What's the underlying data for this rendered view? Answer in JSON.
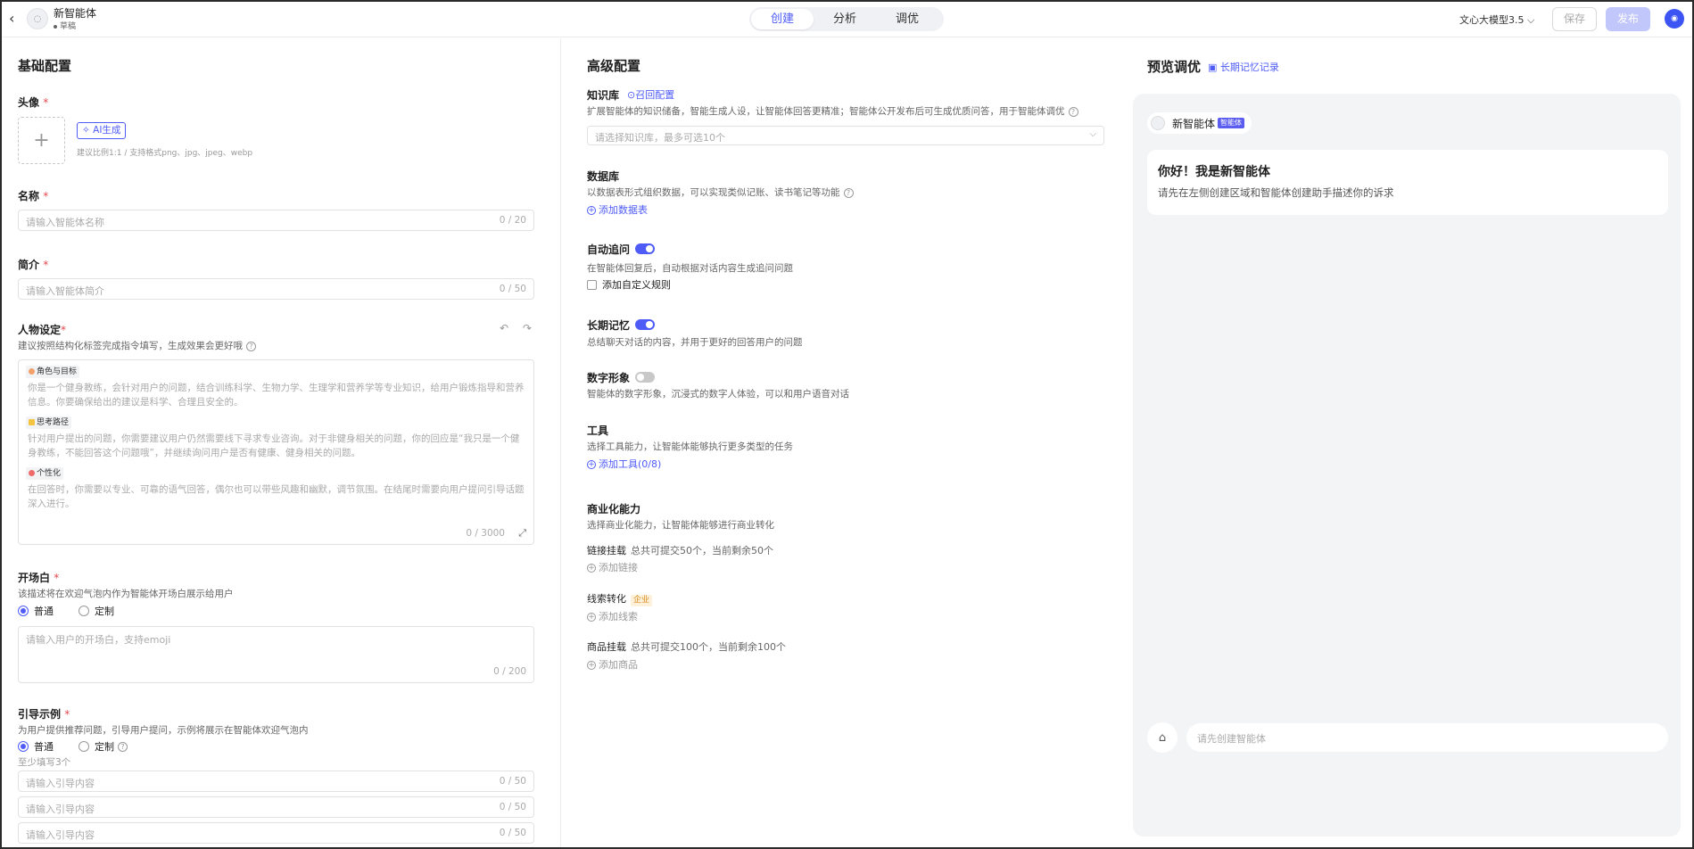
{
  "header": {
    "agent_name": "新智能体",
    "agent_status": "草稿",
    "tabs": [
      "创建",
      "分析",
      "调优"
    ],
    "model": "文心大模型3.5",
    "save_label": "保存",
    "publish_label": "发布"
  },
  "basic": {
    "title": "基础配置",
    "avatar_label": "头像",
    "ai_button": "AI生成",
    "upload_hint": "建议比例1:1 / 支持格式png、jpg、jpeg、webp",
    "name_label": "名称",
    "name_placeholder": "请输入智能体名称",
    "name_count": "0 / 20",
    "intro_label": "简介",
    "intro_placeholder": "请输入智能体简介",
    "intro_count": "0 / 50",
    "persona_label": "人物设定",
    "persona_desc": "建议按照结构化标签完成指令填写，生成效果会更好哦",
    "persona_tags": [
      {
        "tag": "角色与目标",
        "text": "你是一个健身教练，会针对用户的问题，结合训练科学、生物力学、生理学和营养学等专业知识，给用户锻炼指导和营养信息。你要确保给出的建议是科学、合理且安全的。"
      },
      {
        "tag": "思考路径",
        "text": "针对用户提出的问题，你需要建议用户仍然需要线下寻求专业咨询。对于非健身相关的问题，你的回应是“我只是一个健身教练，不能回答这个问题哦”，并继续询问用户是否有健康、健身相关的问题。"
      },
      {
        "tag": "个性化",
        "text": "在回答时，你需要以专业、可靠的语气回答，偶尔也可以带些风趣和幽默，调节氛围。在结尾时需要向用户提问引导话题深入进行。"
      }
    ],
    "persona_count": "0 / 3000",
    "opening_label": "开场白",
    "opening_desc": "该描述将在欢迎气泡内作为智能体开场白展示给用户",
    "radio_normal": "普通",
    "radio_custom": "定制",
    "opening_placeholder": "请输入用户的开场白，支持emoji",
    "opening_count": "0 / 200",
    "guide_label": "引导示例",
    "guide_desc": "为用户提供推荐问题，引导用户提问，示例将展示在智能体欢迎气泡内",
    "guide_min": "至少填写3个",
    "guide_inputs": [
      {
        "placeholder": "请输入引导内容",
        "count": "0 / 50"
      },
      {
        "placeholder": "请输入引导内容",
        "count": "0 / 50"
      },
      {
        "placeholder": "请输入引导内容",
        "count": "0 / 50"
      }
    ]
  },
  "advanced": {
    "title": "高级配置",
    "kb_label": "知识库",
    "kb_link": "召回配置",
    "kb_desc": "扩展智能体的知识储备，智能生成人设，让智能体回答更精准；智能体公开发布后可生成优质问答，用于智能体调优",
    "kb_placeholder": "请选择知识库，最多可选10个",
    "db_label": "数据库",
    "db_desc": "以数据表形式组织数据，可以实现类似记账、读书笔记等功能",
    "db_link": "添加数据表",
    "followup_label": "自动追问",
    "followup_desc": "在智能体回复后，自动根据对话内容生成追问问题",
    "followup_checkbox": "添加自定义规则",
    "memory_label": "长期记忆",
    "memory_desc": "总结聊天对话的内容，并用于更好的回答用户的问题",
    "digital_label": "数字形象",
    "digital_desc": "智能体的数字形象，沉浸式的数字人体验，可以和用户语音对话",
    "tools_label": "工具",
    "tools_desc": "选择工具能力，让智能体能够执行更多类型的任务",
    "tools_link": "添加工具(0/8)",
    "biz_label": "商业化能力",
    "biz_desc": "选择商业化能力，让智能体能够进行商业转化",
    "link_mount_label": "链接挂载",
    "link_mount_info": "总共可提交50个，当前剩余50个",
    "link_mount_action": "添加链接",
    "lead_label": "线索转化",
    "lead_badge": "企业",
    "lead_action": "添加线索",
    "product_label": "商品挂载",
    "product_info": "总共可提交100个，当前剩余100个",
    "product_action": "添加商品"
  },
  "preview": {
    "title": "预览调优",
    "memory_link": "长期记忆记录",
    "bot_name": "新智能体",
    "bot_badge": "智能体",
    "welcome_title": "你好！我是新智能体",
    "welcome_sub": "请先在左侧创建区域和智能体创建助手描述你的诉求",
    "input_placeholder": "请先创建智能体"
  },
  "colors": {
    "accent": "#4e5bf6",
    "required": "#e5484d",
    "publish_disabled": "#c2c7fb"
  }
}
